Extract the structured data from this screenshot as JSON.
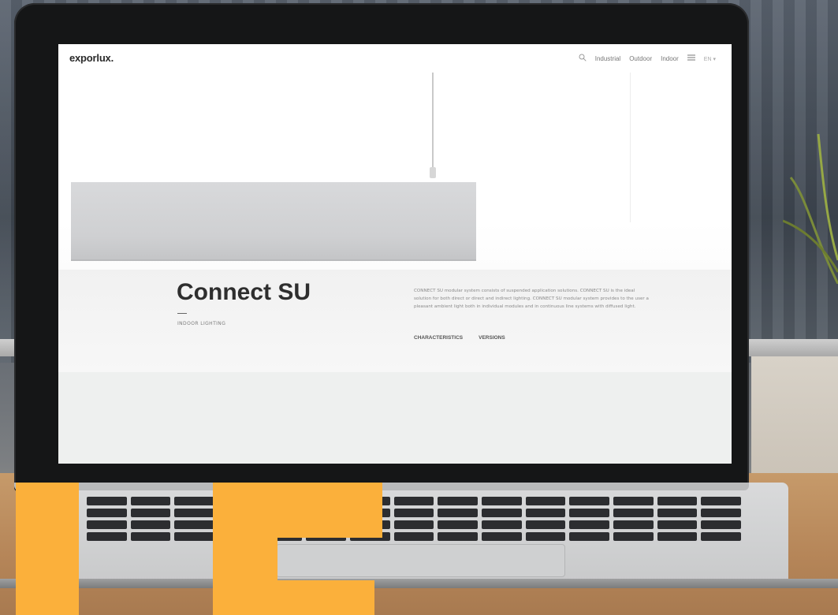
{
  "site": {
    "logo": "exporlux.",
    "nav": {
      "items": [
        "Industrial",
        "Outdoor",
        "Indoor"
      ],
      "language": "EN"
    }
  },
  "product": {
    "title": "Connect SU",
    "category": "INDOOR LIGHTING",
    "description": "CONNECT SU modular system consists of suspended application solutions. CONNECT SU is the ideal solution for both direct or direct and indirect lighting. CONNECT SU modular system provides to the user a pleasant ambient light both in individual modules and in continuous line systems with diffused light.",
    "links": [
      "CHARACTERISTICS",
      "VERSIONS"
    ]
  },
  "colors": {
    "accent": "#fbb03b",
    "laptop_bezel": "#151617"
  },
  "icons": {
    "search": "search-icon",
    "menu": "menu-icon",
    "language_chevron": "chevron-down-icon"
  }
}
